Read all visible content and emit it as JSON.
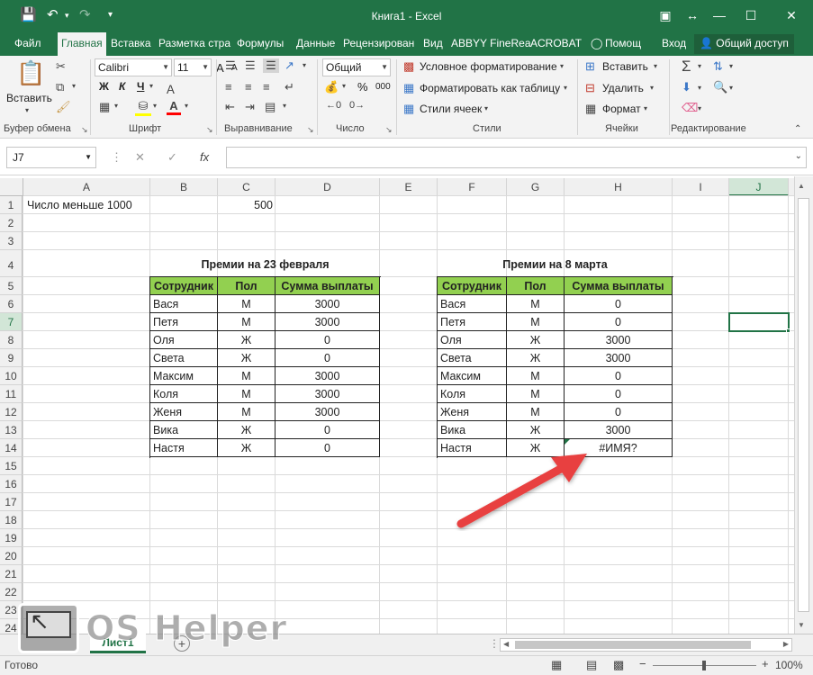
{
  "titlebar": {
    "title": "Книга1 - Excel",
    "save_icon": "save-icon",
    "undo_icon": "undo-icon",
    "redo_icon": "redo-icon"
  },
  "tabs": [
    {
      "label": "Файл"
    },
    {
      "label": "Главная"
    },
    {
      "label": "Вставка"
    },
    {
      "label": "Разметка стра"
    },
    {
      "label": "Формулы"
    },
    {
      "label": "Данные"
    },
    {
      "label": "Рецензирован"
    },
    {
      "label": "Вид"
    },
    {
      "label": "ABBYY FineRea"
    },
    {
      "label": "ACROBAT"
    },
    {
      "label": "Помощ"
    },
    {
      "label": "Вход"
    }
  ],
  "share_label": "Общий доступ",
  "ribbon": {
    "clipboard": {
      "paste": "Вставить",
      "label": "Буфер обмена"
    },
    "font": {
      "name": "Calibri",
      "size": "11",
      "bold": "Ж",
      "italic": "К",
      "underline": "Ч",
      "grow": "A",
      "shrink": "A",
      "label": "Шрифт"
    },
    "alignment": {
      "label": "Выравнивание"
    },
    "number": {
      "format": "Общий",
      "percent": "%",
      "thousands": "000",
      "label": "Число"
    },
    "styles": {
      "conditional": "Условное форматирование",
      "as_table": "Форматировать как таблицу",
      "cell_styles": "Стили ячеек",
      "label": "Стили"
    },
    "cells": {
      "insert": "Вставить",
      "delete": "Удалить",
      "format": "Формат",
      "label": "Ячейки"
    },
    "editing": {
      "label": "Редактирование"
    }
  },
  "formula_bar": {
    "name_box": "J7",
    "fx": "fx",
    "value": ""
  },
  "columns": [
    "A",
    "B",
    "C",
    "D",
    "E",
    "F",
    "G",
    "H",
    "I",
    "J"
  ],
  "rows": [
    "1",
    "2",
    "3",
    "4",
    "5",
    "6",
    "7",
    "8",
    "9",
    "10",
    "11",
    "12",
    "13",
    "14",
    "15",
    "16",
    "17",
    "18",
    "19",
    "20",
    "21",
    "22",
    "23",
    "24"
  ],
  "sheet": {
    "a1": "Число меньше 1000",
    "c1": "500",
    "table1": {
      "title": "Премии на 23 февраля",
      "headers": [
        "Сотрудник",
        "Пол",
        "Сумма выплаты"
      ],
      "rows": [
        [
          "Вася",
          "М",
          "3000"
        ],
        [
          "Петя",
          "М",
          "3000"
        ],
        [
          "Оля",
          "Ж",
          "0"
        ],
        [
          "Света",
          "Ж",
          "0"
        ],
        [
          "Максим",
          "М",
          "3000"
        ],
        [
          "Коля",
          "М",
          "3000"
        ],
        [
          "Женя",
          "М",
          "3000"
        ],
        [
          "Вика",
          "Ж",
          "0"
        ],
        [
          "Настя",
          "Ж",
          "0"
        ]
      ]
    },
    "table2": {
      "title": "Премии на 8 марта",
      "headers": [
        "Сотрудник",
        "Пол",
        "Сумма выплаты"
      ],
      "rows": [
        [
          "Вася",
          "М",
          "0"
        ],
        [
          "Петя",
          "М",
          "0"
        ],
        [
          "Оля",
          "Ж",
          "3000"
        ],
        [
          "Света",
          "Ж",
          "3000"
        ],
        [
          "Максим",
          "М",
          "0"
        ],
        [
          "Коля",
          "М",
          "0"
        ],
        [
          "Женя",
          "М",
          "0"
        ],
        [
          "Вика",
          "Ж",
          "3000"
        ],
        [
          "Настя",
          "Ж",
          "#ИМЯ?"
        ]
      ]
    }
  },
  "sheet_tab": "Лист1",
  "status": {
    "ready": "Готово",
    "zoom": "100%"
  },
  "watermark": "OS Helper",
  "colors": {
    "accent": "#217346",
    "header_fill": "#92d050",
    "arrow": "#e8413f"
  }
}
